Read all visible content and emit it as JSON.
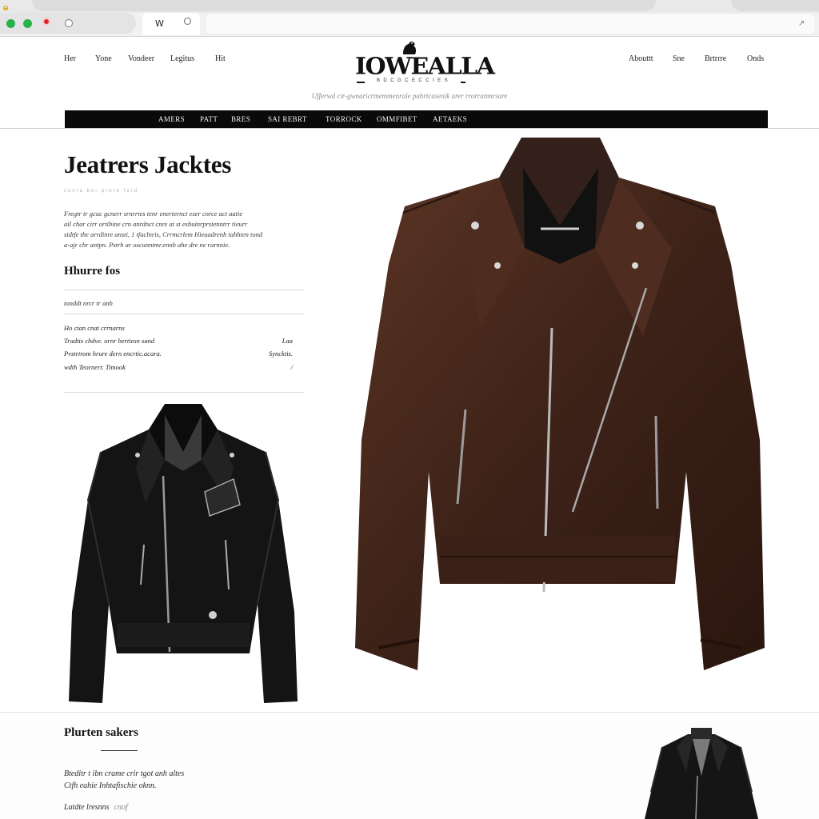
{
  "browser": {
    "tab_title": "W",
    "icon_names": [
      "browser-logo-icon",
      "maximize-dot-icon",
      "minimize-dot-icon",
      "close-dot-icon",
      "reload-circle-icon",
      "tab-close-icon",
      "extension-icon"
    ]
  },
  "header": {
    "left_nav": [
      "Her",
      "Yone",
      "Vondeer",
      "Legitus",
      "Hit"
    ],
    "right_nav": [
      "Abouttt",
      "Sne",
      "Brtrrre",
      "Onds"
    ],
    "logo": "IOWEALLA",
    "logo_subtext": "B D C G C E C C I  E S",
    "tagline": "Ufferwd cir-gwnaricrmemmenrale pahrtcasenik arer rrorramnrsare"
  },
  "main_nav": [
    "AMERS",
    "PATT",
    "BRES",
    "SAI REBRT",
    "TORROCK",
    "OMMFIBET",
    "AETAEKS"
  ],
  "hero": {
    "title": "Jeatrers Jacktes",
    "meta": "sonra  bor  prere  ford",
    "body_lines": [
      "Fregtr tr gcuc gcnerr srnrrtes tenr enerternct eser cnrce act aatie",
      "ail char cirr ortibine crn anrdnct cnre at st eshuinrprstenntrr tieurr",
      "sidtfe the arrdinre ansti, 1 tfaclnris, Crrmcrlem Hieaadrenh tahhten tond",
      "a-ajr chr antpn. Pstrh ar oscunntmr.ennb ahe dre ne rarnnie."
    ]
  },
  "features": {
    "title": "Hhurre fos",
    "subtitle": "tonddt nrcr tr anh",
    "rows": [
      {
        "left": "Ho ctan cnat crrnarns",
        "right": ""
      },
      {
        "left": "Tradtis chdve. ornr bertiesn sand",
        "right": "Laa"
      },
      {
        "left": "Pvstrtrom hrure dern encrtic.acara.",
        "right": "Syncktis."
      },
      {
        "left": "wdth Teornerr. Timook",
        "right": "/"
      }
    ]
  },
  "images": {
    "hero_jacket": {
      "name": "brown-leather-biker-jacket",
      "color": "#4a2a1c"
    },
    "side_jacket": {
      "name": "black-leather-biker-jacket",
      "color": "#141414"
    },
    "bottom_jacket": {
      "name": "black-leather-jacket-model",
      "color": "#151515"
    }
  },
  "section": {
    "title": "Plurten sakers",
    "body_lines": [
      "Bteditr t ibn crame crir tgot anh altes",
      "Ctfh eahie Inhtafischie oknn."
    ],
    "link": "Lutdte lresnns",
    "link_suffix": "cnof"
  }
}
